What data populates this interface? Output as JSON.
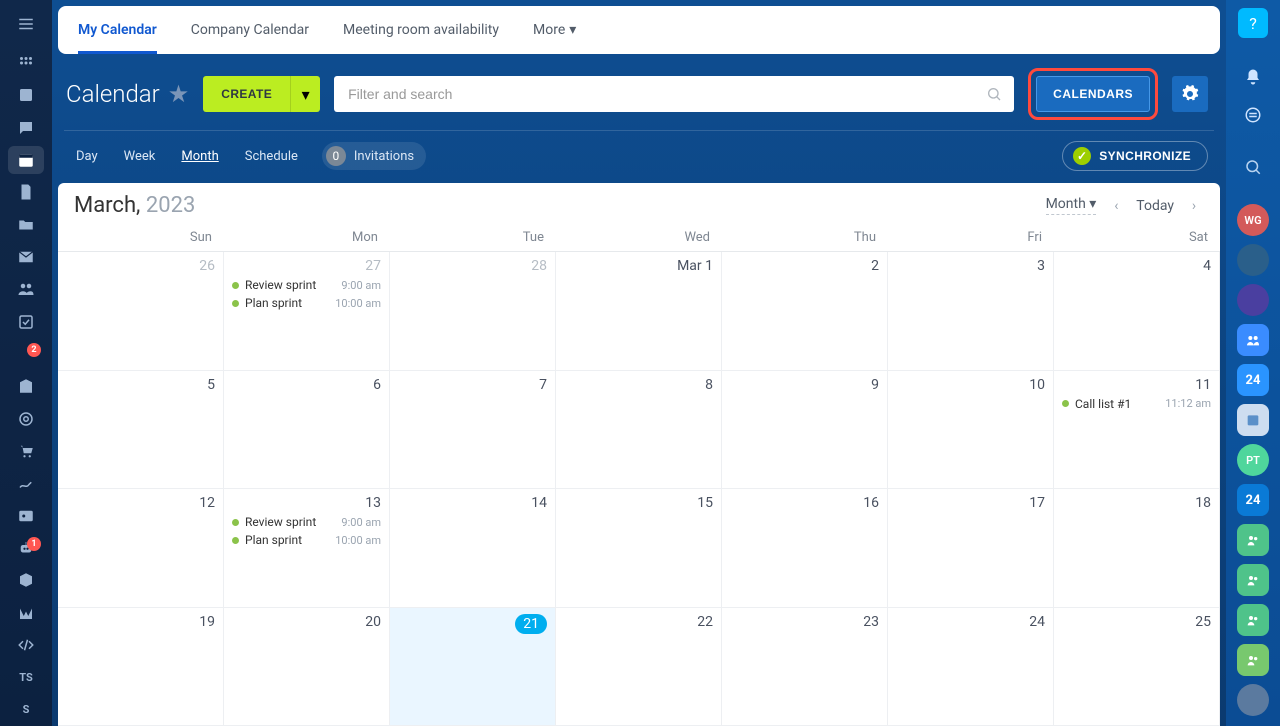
{
  "tabs": [
    "My Calendar",
    "Company Calendar",
    "Meeting room availability",
    "More"
  ],
  "active_tab_index": 0,
  "title": "Calendar",
  "create_label": "CREATE",
  "search_placeholder": "Filter and search",
  "calendars_label": "CALENDARS",
  "views": [
    "Day",
    "Week",
    "Month",
    "Schedule"
  ],
  "active_view_index": 2,
  "invitations_label": "Invitations",
  "invitations_count": "0",
  "sync_label": "SYNCHRONIZE",
  "month_label_a": "March,",
  "month_label_b": "2023",
  "view_selector": "Month",
  "today_label": "Today",
  "dow": [
    "Sun",
    "Mon",
    "Tue",
    "Wed",
    "Thu",
    "Fri",
    "Sat"
  ],
  "rail_badges": {
    "filter": "2",
    "bot": "1"
  },
  "rail_txt1": "TS",
  "rail_txt2": "S",
  "presence": {
    "wg": "WG",
    "n24": "24",
    "pt": "PT"
  },
  "cells": [
    {
      "dt": "26",
      "dim": true
    },
    {
      "dt": "27",
      "dim": true,
      "events": [
        {
          "t": "Review sprint",
          "tm": "9:00 am"
        },
        {
          "t": "Plan sprint",
          "tm": "10:00 am"
        }
      ]
    },
    {
      "dt": "28",
      "dim": true
    },
    {
      "dt": "Mar 1"
    },
    {
      "dt": "2"
    },
    {
      "dt": "3"
    },
    {
      "dt": "4"
    },
    {
      "dt": "5"
    },
    {
      "dt": "6"
    },
    {
      "dt": "7"
    },
    {
      "dt": "8"
    },
    {
      "dt": "9"
    },
    {
      "dt": "10"
    },
    {
      "dt": "11",
      "events": [
        {
          "t": "Call list #1",
          "tm": "11:12 am"
        }
      ]
    },
    {
      "dt": "12"
    },
    {
      "dt": "13",
      "events": [
        {
          "t": "Review sprint",
          "tm": "9:00 am"
        },
        {
          "t": "Plan sprint",
          "tm": "10:00 am"
        }
      ]
    },
    {
      "dt": "14"
    },
    {
      "dt": "15"
    },
    {
      "dt": "16"
    },
    {
      "dt": "17"
    },
    {
      "dt": "18"
    },
    {
      "dt": "19"
    },
    {
      "dt": "20"
    },
    {
      "dt": "21",
      "today": true
    },
    {
      "dt": "22"
    },
    {
      "dt": "23"
    },
    {
      "dt": "24"
    },
    {
      "dt": "25"
    }
  ]
}
